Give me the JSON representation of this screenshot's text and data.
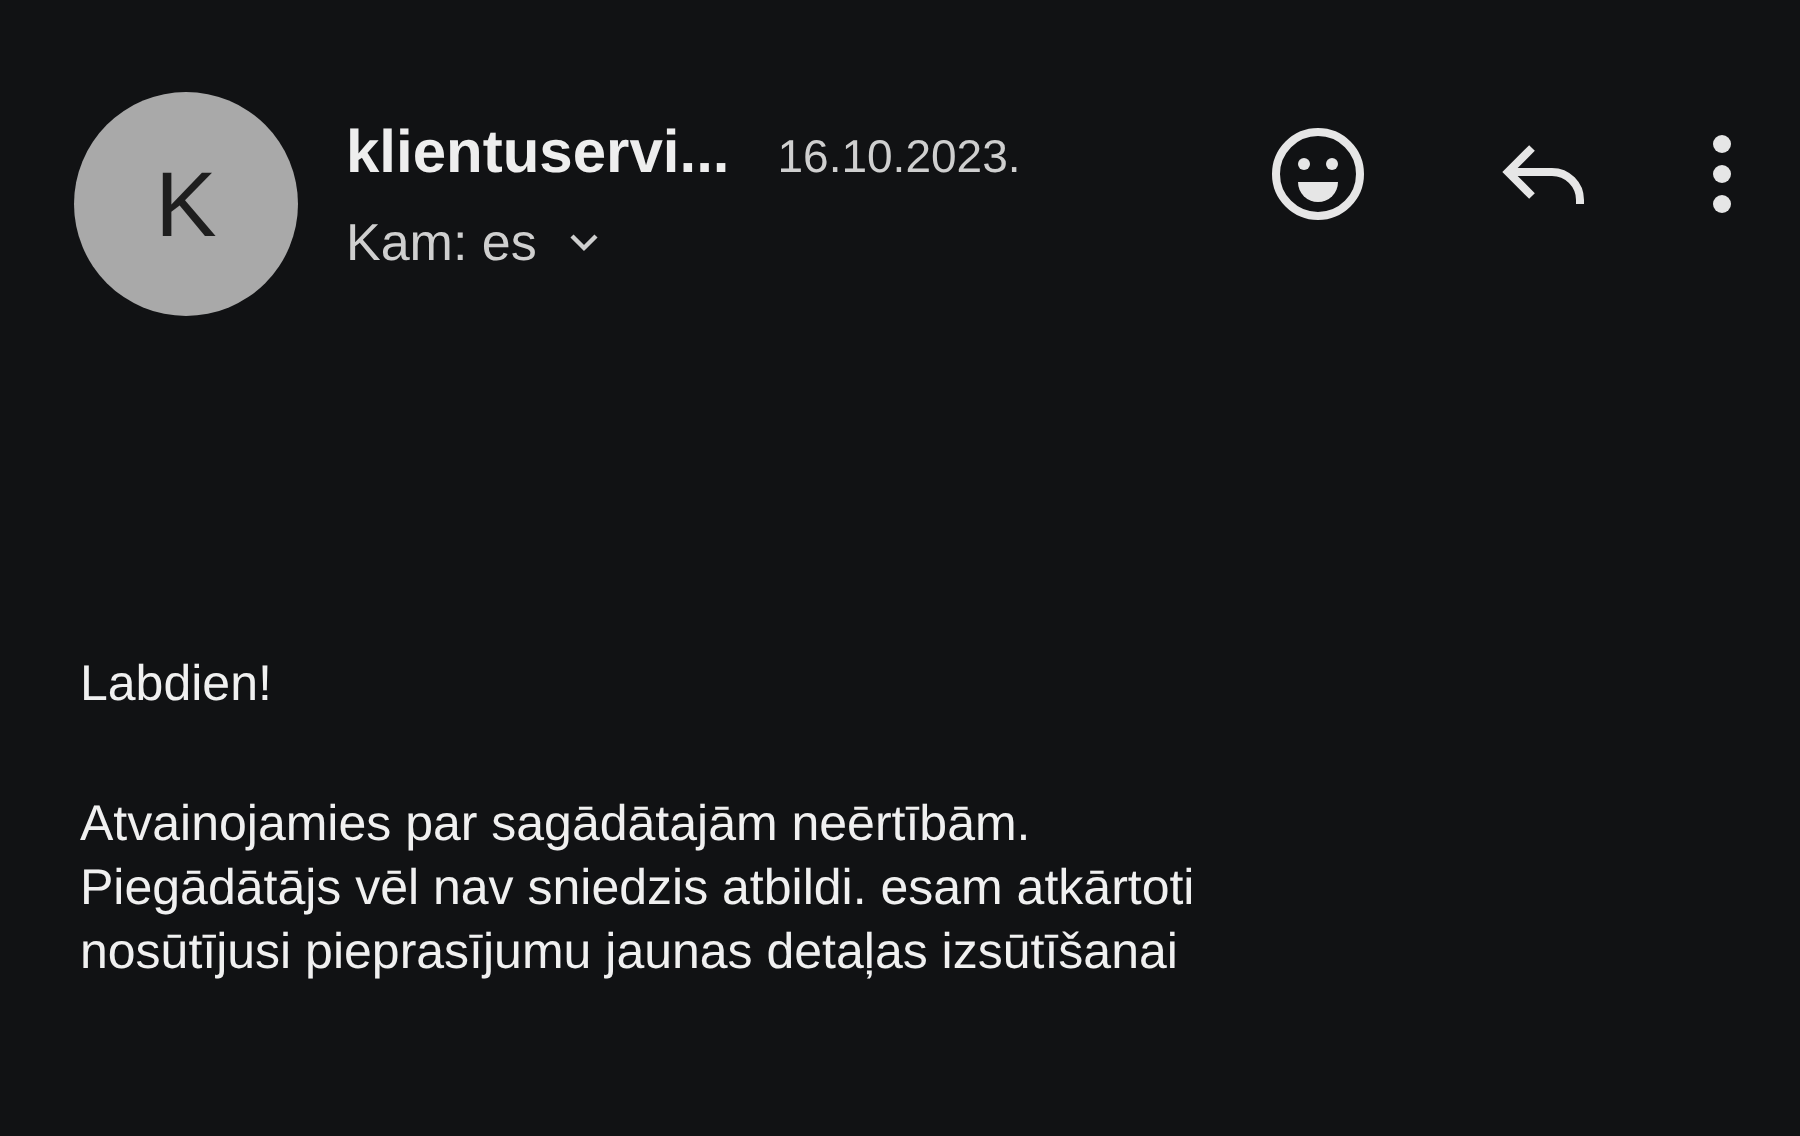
{
  "sender": {
    "initial": "K",
    "name": "klientuservi...",
    "date": "16.10.2023.",
    "recipient": "Kam: es"
  },
  "body": {
    "greeting": "Labdien!",
    "paragraph_lines": [
      "Atvainojamies par sagādātajām neērtībām.",
      "Piegādātājs vēl nav sniedzis atbildi. esam atkārtoti",
      "nosūtījusi pieprasījumu jaunas detaļas izsūtīšanai"
    ]
  }
}
